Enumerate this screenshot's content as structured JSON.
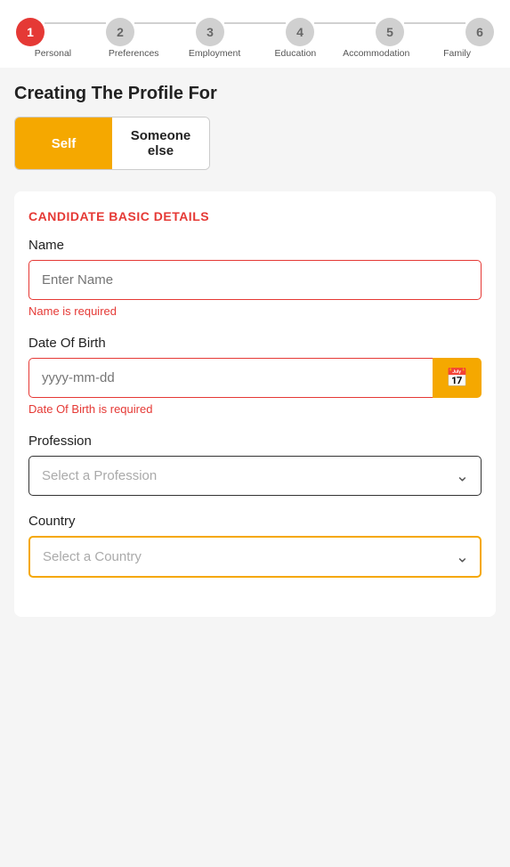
{
  "stepper": {
    "steps": [
      {
        "number": "1",
        "label": "Personal",
        "active": true
      },
      {
        "number": "2",
        "label": "Preferences",
        "active": false
      },
      {
        "number": "3",
        "label": "Employment",
        "active": false
      },
      {
        "number": "4",
        "label": "Education",
        "active": false
      },
      {
        "number": "5",
        "label": "Accommodation",
        "active": false
      },
      {
        "number": "6",
        "label": "Family",
        "active": false
      }
    ]
  },
  "page": {
    "section_title": "Creating The Profile For",
    "toggle": {
      "self_label": "Self",
      "other_label": "Someone else"
    },
    "form": {
      "heading": "CANDIDATE BASIC DETAILS",
      "name_label": "Name",
      "name_placeholder": "Enter Name",
      "name_error": "Name is required",
      "dob_label": "Date Of Birth",
      "dob_placeholder": "yyyy-mm-dd",
      "dob_error": "Date Of Birth is required",
      "profession_label": "Profession",
      "profession_placeholder": "Select a Profession",
      "country_label": "Country",
      "country_placeholder": "Select a Country"
    }
  },
  "colors": {
    "active_step": "#e53935",
    "inactive_step": "#d0d0d0",
    "accent_yellow": "#f5a800",
    "error_red": "#e53935"
  }
}
